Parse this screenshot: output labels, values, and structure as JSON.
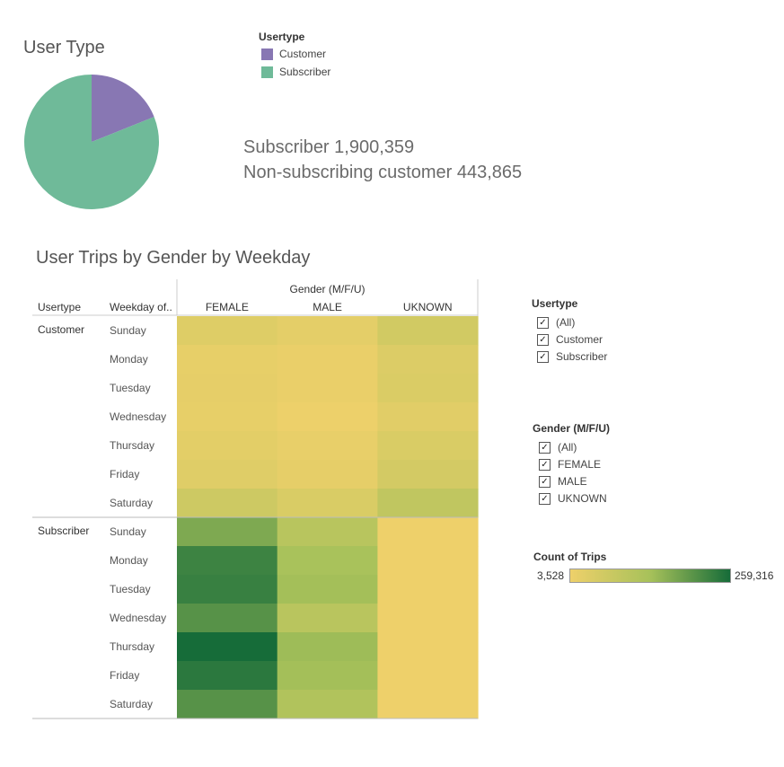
{
  "colors": {
    "customer": "#8877b3",
    "subscriber": "#6fba99",
    "scale_low": "#eed06a",
    "scale_mid": "#a7c15a",
    "scale_high": "#166c39"
  },
  "pie": {
    "title": "User Type",
    "legend_title": "Usertype",
    "legend": [
      "Customer",
      "Subscriber"
    ]
  },
  "stats": {
    "subscriber_line": "Subscriber 1,900,359",
    "customer_line": "Non-subscribing customer 443,865"
  },
  "heatmap": {
    "title": "User Trips by Gender by Weekday",
    "column_group_header": "Gender (M/F/U)",
    "row_header_usertype": "Usertype",
    "row_header_weekday": "Weekday of..",
    "columns": [
      "FEMALE",
      "MALE",
      "UKNOWN"
    ],
    "groups": [
      "Customer",
      "Subscriber"
    ],
    "weekdays": [
      "Sunday",
      "Monday",
      "Tuesday",
      "Wednesday",
      "Thursday",
      "Friday",
      "Saturday"
    ]
  },
  "filters": {
    "usertype": {
      "title": "Usertype",
      "options": [
        "(All)",
        "Customer",
        "Subscriber"
      ]
    },
    "gender": {
      "title": "Gender (M/F/U)",
      "options": [
        "(All)",
        "FEMALE",
        "MALE",
        "UKNOWN"
      ]
    }
  },
  "color_scale": {
    "title": "Count of Trips",
    "min_label": "3,528",
    "max_label": "259,316"
  },
  "chart_data": [
    {
      "type": "pie",
      "title": "User Type",
      "labels": [
        "Customer",
        "Subscriber"
      ],
      "values": [
        443865,
        1900359
      ],
      "colors": [
        "#8877b3",
        "#6fba99"
      ]
    },
    {
      "type": "heatmap",
      "title": "User Trips by Gender by Weekday",
      "columns": [
        "FEMALE",
        "MALE",
        "UKNOWN"
      ],
      "rows": [
        {
          "usertype": "Customer",
          "weekday": "Sunday",
          "values": [
            24000,
            16000,
            40000
          ]
        },
        {
          "usertype": "Customer",
          "weekday": "Monday",
          "values": [
            12000,
            8000,
            26000
          ]
        },
        {
          "usertype": "Customer",
          "weekday": "Tuesday",
          "values": [
            13000,
            8000,
            29000
          ]
        },
        {
          "usertype": "Customer",
          "weekday": "Wednesday",
          "values": [
            12000,
            5000,
            20000
          ]
        },
        {
          "usertype": "Customer",
          "weekday": "Thursday",
          "values": [
            18000,
            11000,
            30000
          ]
        },
        {
          "usertype": "Customer",
          "weekday": "Friday",
          "values": [
            23000,
            14000,
            37000
          ]
        },
        {
          "usertype": "Customer",
          "weekday": "Saturday",
          "values": [
            45000,
            30000,
            62000
          ]
        },
        {
          "usertype": "Subscriber",
          "weekday": "Sunday",
          "values": [
            140000,
            72000,
            3528
          ]
        },
        {
          "usertype": "Subscriber",
          "weekday": "Monday",
          "values": [
            215000,
            90000,
            3528
          ]
        },
        {
          "usertype": "Subscriber",
          "weekday": "Tuesday",
          "values": [
            220000,
            96000,
            3528
          ]
        },
        {
          "usertype": "Subscriber",
          "weekday": "Wednesday",
          "values": [
            185000,
            70000,
            3528
          ]
        },
        {
          "usertype": "Subscriber",
          "weekday": "Thursday",
          "values": [
            259316,
            103000,
            3528
          ]
        },
        {
          "usertype": "Subscriber",
          "weekday": "Friday",
          "values": [
            235000,
            96000,
            3528
          ]
        },
        {
          "usertype": "Subscriber",
          "weekday": "Saturday",
          "values": [
            185000,
            80000,
            3528
          ]
        }
      ],
      "color_range": [
        3528,
        259316
      ],
      "legend_title": "Count of Trips"
    }
  ]
}
